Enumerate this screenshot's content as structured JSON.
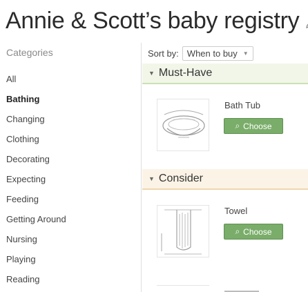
{
  "page": {
    "title": "Annie & Scott’s baby registry"
  },
  "sidebar": {
    "heading": "Categories",
    "items": [
      {
        "label": "All"
      },
      {
        "label": "Bathing"
      },
      {
        "label": "Changing"
      },
      {
        "label": "Clothing"
      },
      {
        "label": "Decorating"
      },
      {
        "label": "Expecting"
      },
      {
        "label": "Feeding"
      },
      {
        "label": "Getting Around"
      },
      {
        "label": "Nursing"
      },
      {
        "label": "Playing"
      },
      {
        "label": "Reading"
      }
    ],
    "active_item": "Bathing"
  },
  "sort": {
    "label": "Sort by:",
    "value": "When to buy"
  },
  "sections": [
    {
      "title": "Must-Have",
      "accent_bg": "#f1f6e9",
      "accent_line": "#cde0b4",
      "items": [
        {
          "name": "Bath Tub",
          "button_label": "Choose",
          "icon": "bath-tub-sketch"
        }
      ]
    },
    {
      "title": "Consider",
      "accent_bg": "#fbf3e6",
      "accent_line": "#f0d6ad",
      "items": [
        {
          "name": "Towel",
          "button_label": "Choose",
          "icon": "towel-sketch"
        }
      ]
    }
  ],
  "colors": {
    "button": "#7aad6a",
    "button_text": "#ffffff"
  }
}
